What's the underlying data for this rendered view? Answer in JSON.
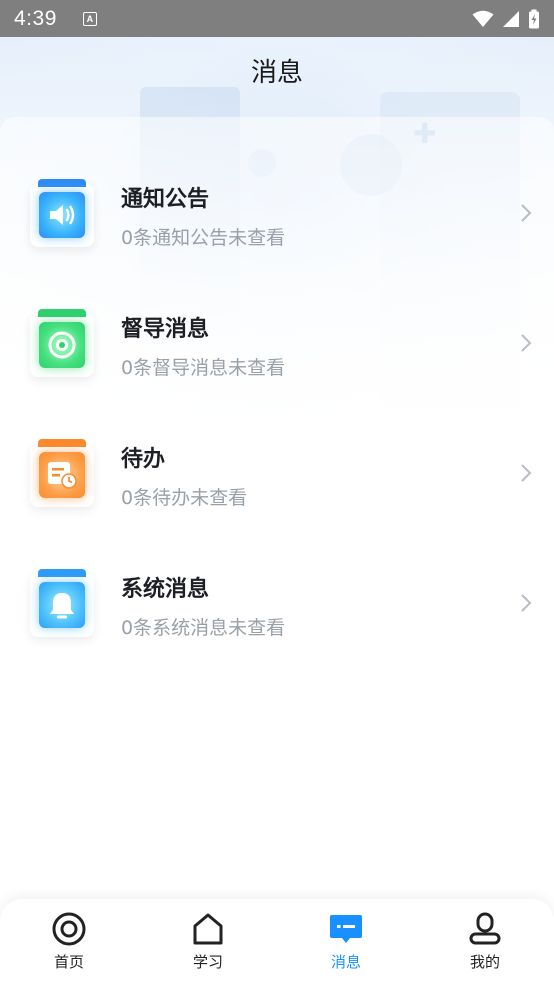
{
  "status_bar": {
    "time": "4:39",
    "indicator": "A"
  },
  "header": {
    "title": "消息"
  },
  "messages": [
    {
      "title": "通知公告",
      "subtitle": "0条通知公告未查看",
      "icon": "speaker-icon",
      "color": "#2f8cf6"
    },
    {
      "title": "督导消息",
      "subtitle": "0条督导消息未查看",
      "icon": "target-icon",
      "color": "#2fd06e"
    },
    {
      "title": "待办",
      "subtitle": "0条待办未查看",
      "icon": "todo-icon",
      "color": "#fb8a2c"
    },
    {
      "title": "系统消息",
      "subtitle": "0条系统消息未查看",
      "icon": "bell-icon",
      "color": "#2f9cf6"
    }
  ],
  "tab_bar": {
    "active_color": "#1890ff",
    "tabs": [
      {
        "label": "首页",
        "icon": "home-circle-icon"
      },
      {
        "label": "学习",
        "icon": "house-icon"
      },
      {
        "label": "消息",
        "icon": "message-icon",
        "active": true
      },
      {
        "label": "我的",
        "icon": "profile-icon"
      }
    ]
  }
}
